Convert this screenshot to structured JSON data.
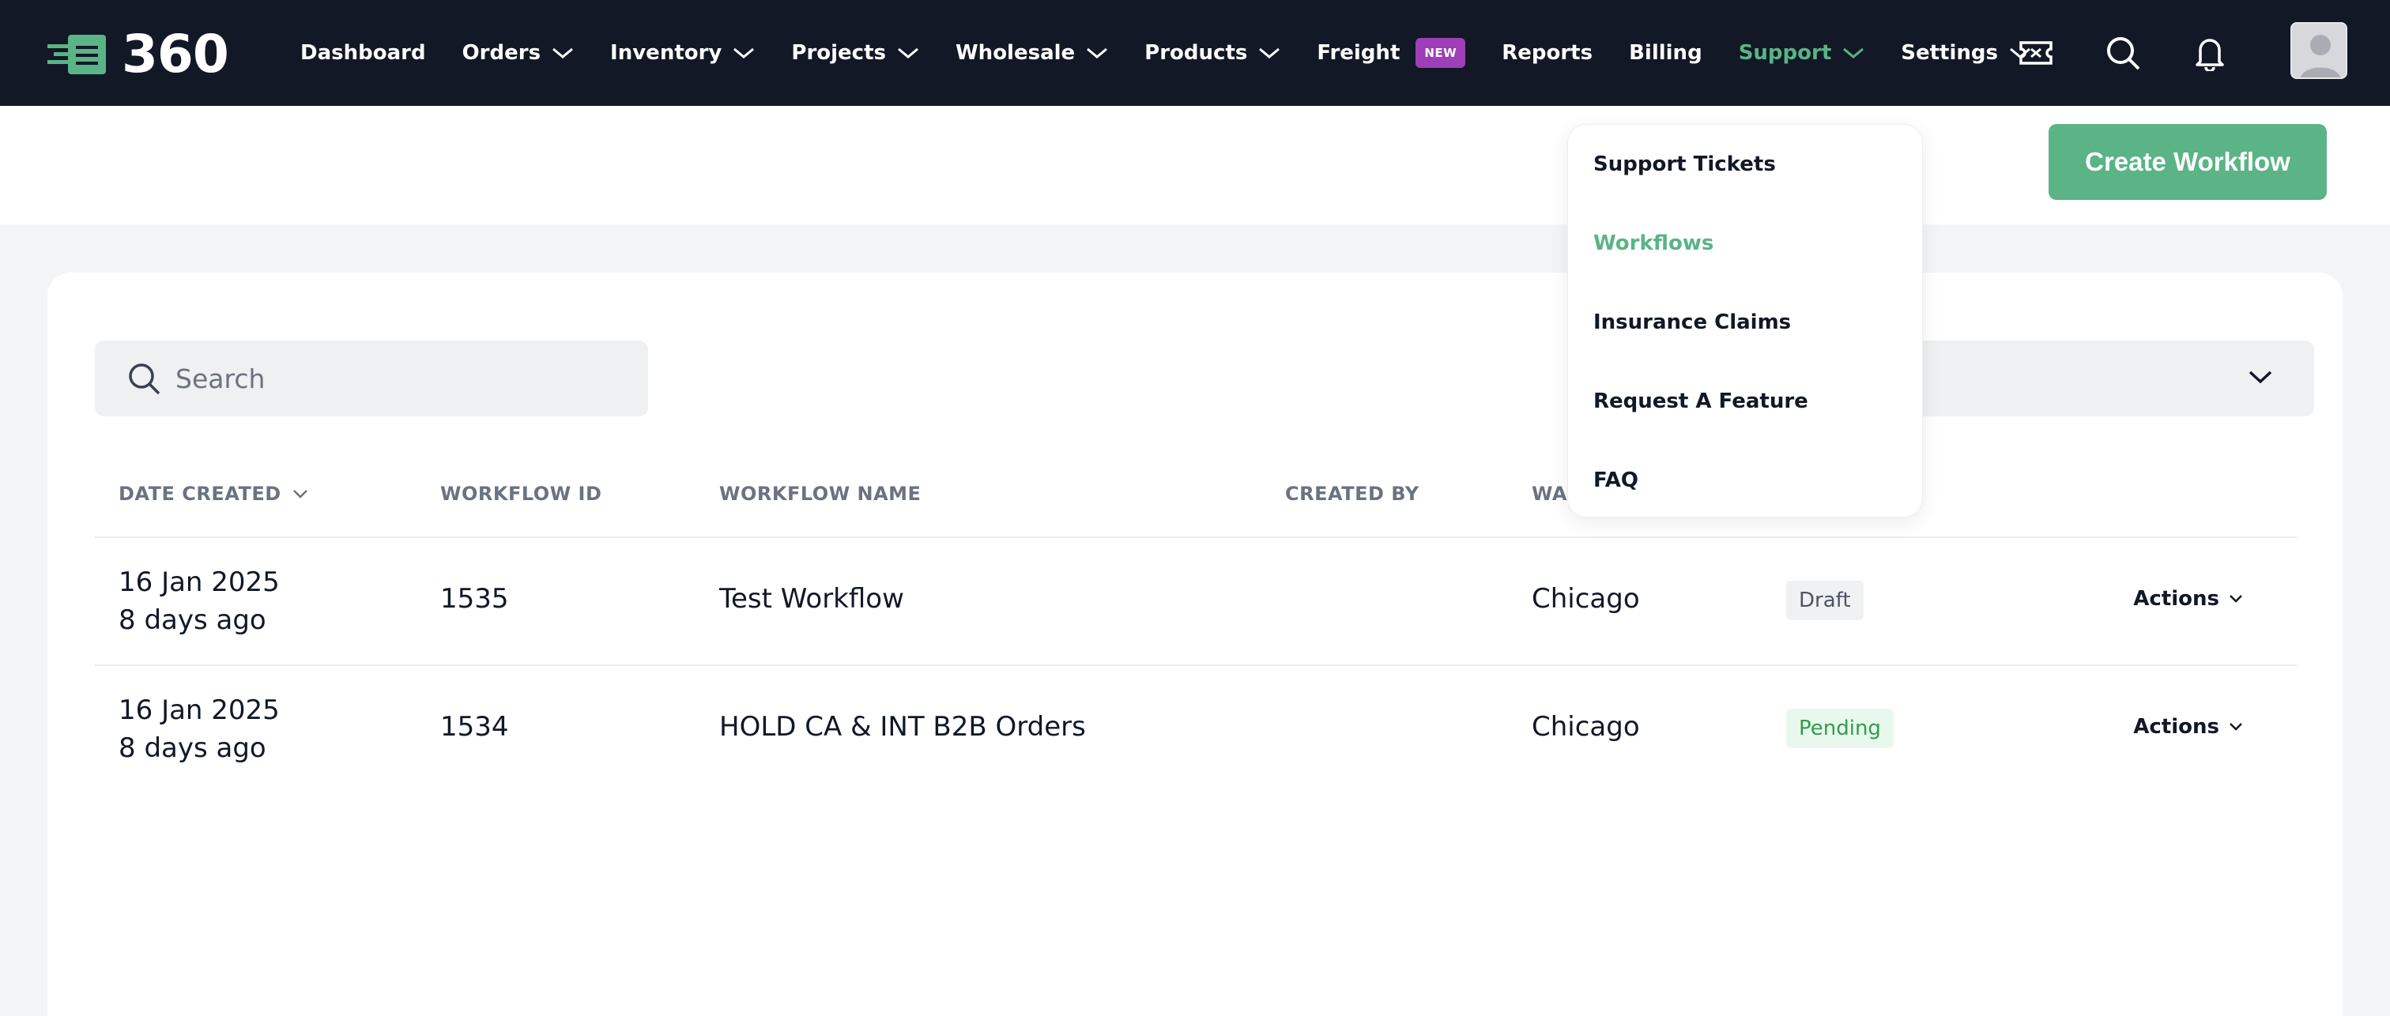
{
  "brand": {
    "text": "360",
    "accent": "#5ab485"
  },
  "nav": {
    "items": [
      {
        "label": "Dashboard",
        "has_dropdown": false
      },
      {
        "label": "Orders",
        "has_dropdown": true
      },
      {
        "label": "Inventory",
        "has_dropdown": true
      },
      {
        "label": "Projects",
        "has_dropdown": true
      },
      {
        "label": "Wholesale",
        "has_dropdown": true
      },
      {
        "label": "Products",
        "has_dropdown": true
      },
      {
        "label": "Freight",
        "badge": "NEW",
        "has_dropdown": false
      },
      {
        "label": "Reports",
        "has_dropdown": false
      },
      {
        "label": "Billing",
        "has_dropdown": false
      },
      {
        "label": "Support",
        "has_dropdown": true,
        "active": true
      },
      {
        "label": "Settings",
        "has_dropdown": true
      }
    ],
    "icons": [
      "ticket-icon",
      "search-icon",
      "bell-icon",
      "avatar"
    ]
  },
  "subheader": {
    "create_button": "Create Workflow"
  },
  "search": {
    "placeholder": "Search"
  },
  "filter": {
    "visible_text": "l"
  },
  "table": {
    "headers": [
      "DATE CREATED",
      "WORKFLOW ID",
      "WORKFLOW NAME",
      "CREATED BY",
      "WA"
    ],
    "rows": [
      {
        "date": "16 Jan 2025",
        "ago": "8 days ago",
        "id": "1535",
        "name": "Test Workflow",
        "created_by": "",
        "warehouse": "Chicago",
        "status": "Draft",
        "actions": "Actions"
      },
      {
        "date": "16 Jan 2025",
        "ago": "8 days ago",
        "id": "1534",
        "name": "HOLD CA & INT B2B Orders",
        "created_by": "",
        "warehouse": "Chicago",
        "status": "Pending",
        "actions": "Actions"
      }
    ]
  },
  "support_menu": {
    "items": [
      {
        "label": "Support Tickets",
        "active": false
      },
      {
        "label": "Workflows",
        "active": true
      },
      {
        "label": "Insurance Claims",
        "active": false
      },
      {
        "label": "Request A Feature",
        "active": false
      },
      {
        "label": "FAQ",
        "active": false
      }
    ]
  },
  "colors": {
    "nav_bg": "#121826",
    "accent_green": "#5ab485",
    "new_badge": "#9c3fb8"
  }
}
